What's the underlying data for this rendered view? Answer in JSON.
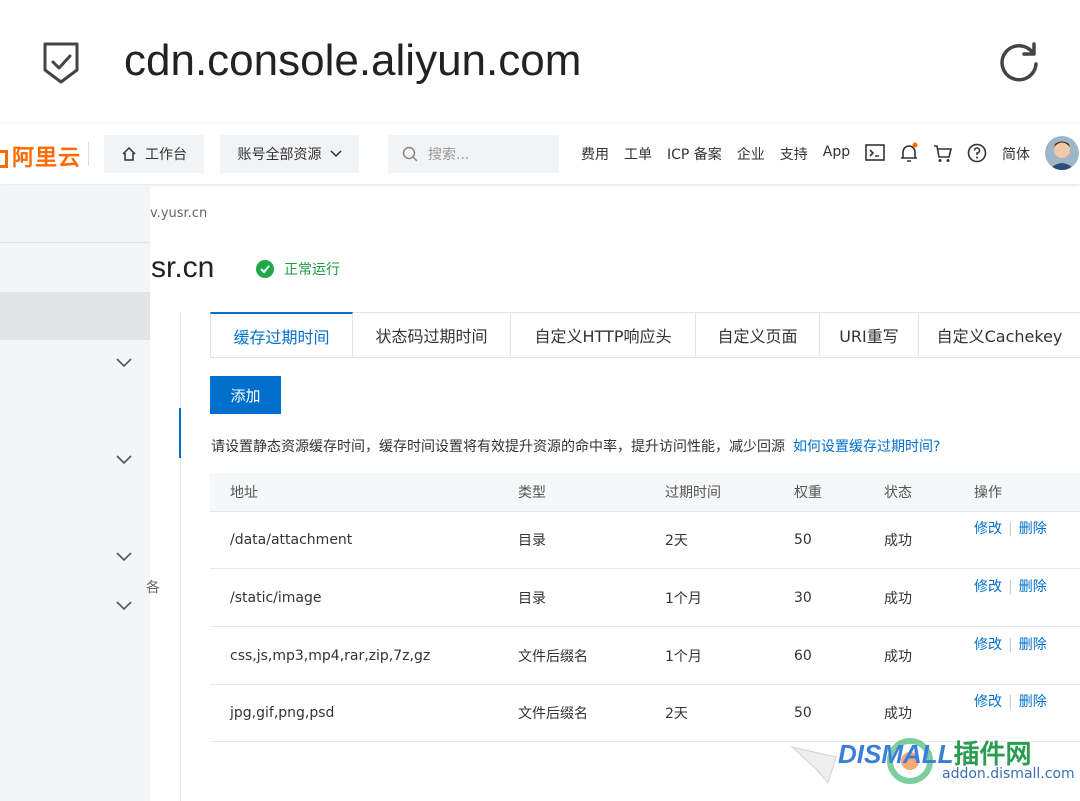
{
  "browser": {
    "url": "cdn.console.aliyun.com"
  },
  "topnav": {
    "logo": "阿里云",
    "workbench": "工作台",
    "resources": "账号全部资源",
    "search_placeholder": "搜索...",
    "links": [
      "费用",
      "工单",
      "ICP 备案",
      "企业",
      "支持",
      "App"
    ],
    "lang": "简体"
  },
  "breadcrumb": "v.yusr.cn",
  "domain_title": "sr.cn",
  "status": "正常运行",
  "sidebar": {
    "footer_char": "各"
  },
  "tabs": [
    "缓存过期时间",
    "状态码过期时间",
    "自定义HTTP响应头",
    "自定义页面",
    "URI重写",
    "自定义Cachekey"
  ],
  "add_button": "添加",
  "tip": {
    "text": "请设置静态资源缓存时间，缓存时间设置将有效提升资源的命中率，提升访问性能，减少回源",
    "link": "如何设置缓存过期时间?"
  },
  "table": {
    "headers": [
      "地址",
      "类型",
      "过期时间",
      "权重",
      "状态",
      "操作"
    ],
    "rows": [
      {
        "address": "/data/attachment",
        "type": "目录",
        "ttl": "2天",
        "weight": "50",
        "status": "成功"
      },
      {
        "address": "/static/image",
        "type": "目录",
        "ttl": "1个月",
        "weight": "30",
        "status": "成功"
      },
      {
        "address": "css,js,mp3,mp4,rar,zip,7z,gz",
        "type": "文件后缀名",
        "ttl": "1个月",
        "weight": "60",
        "status": "成功"
      },
      {
        "address": "jpg,gif,png,psd",
        "type": "文件后缀名",
        "ttl": "2天",
        "weight": "50",
        "status": "成功"
      }
    ],
    "op_edit": "修改",
    "op_delete": "删除"
  },
  "watermark": {
    "brand": "DISMALL",
    "cn": "插件网",
    "url": "addon.dismall.com"
  }
}
